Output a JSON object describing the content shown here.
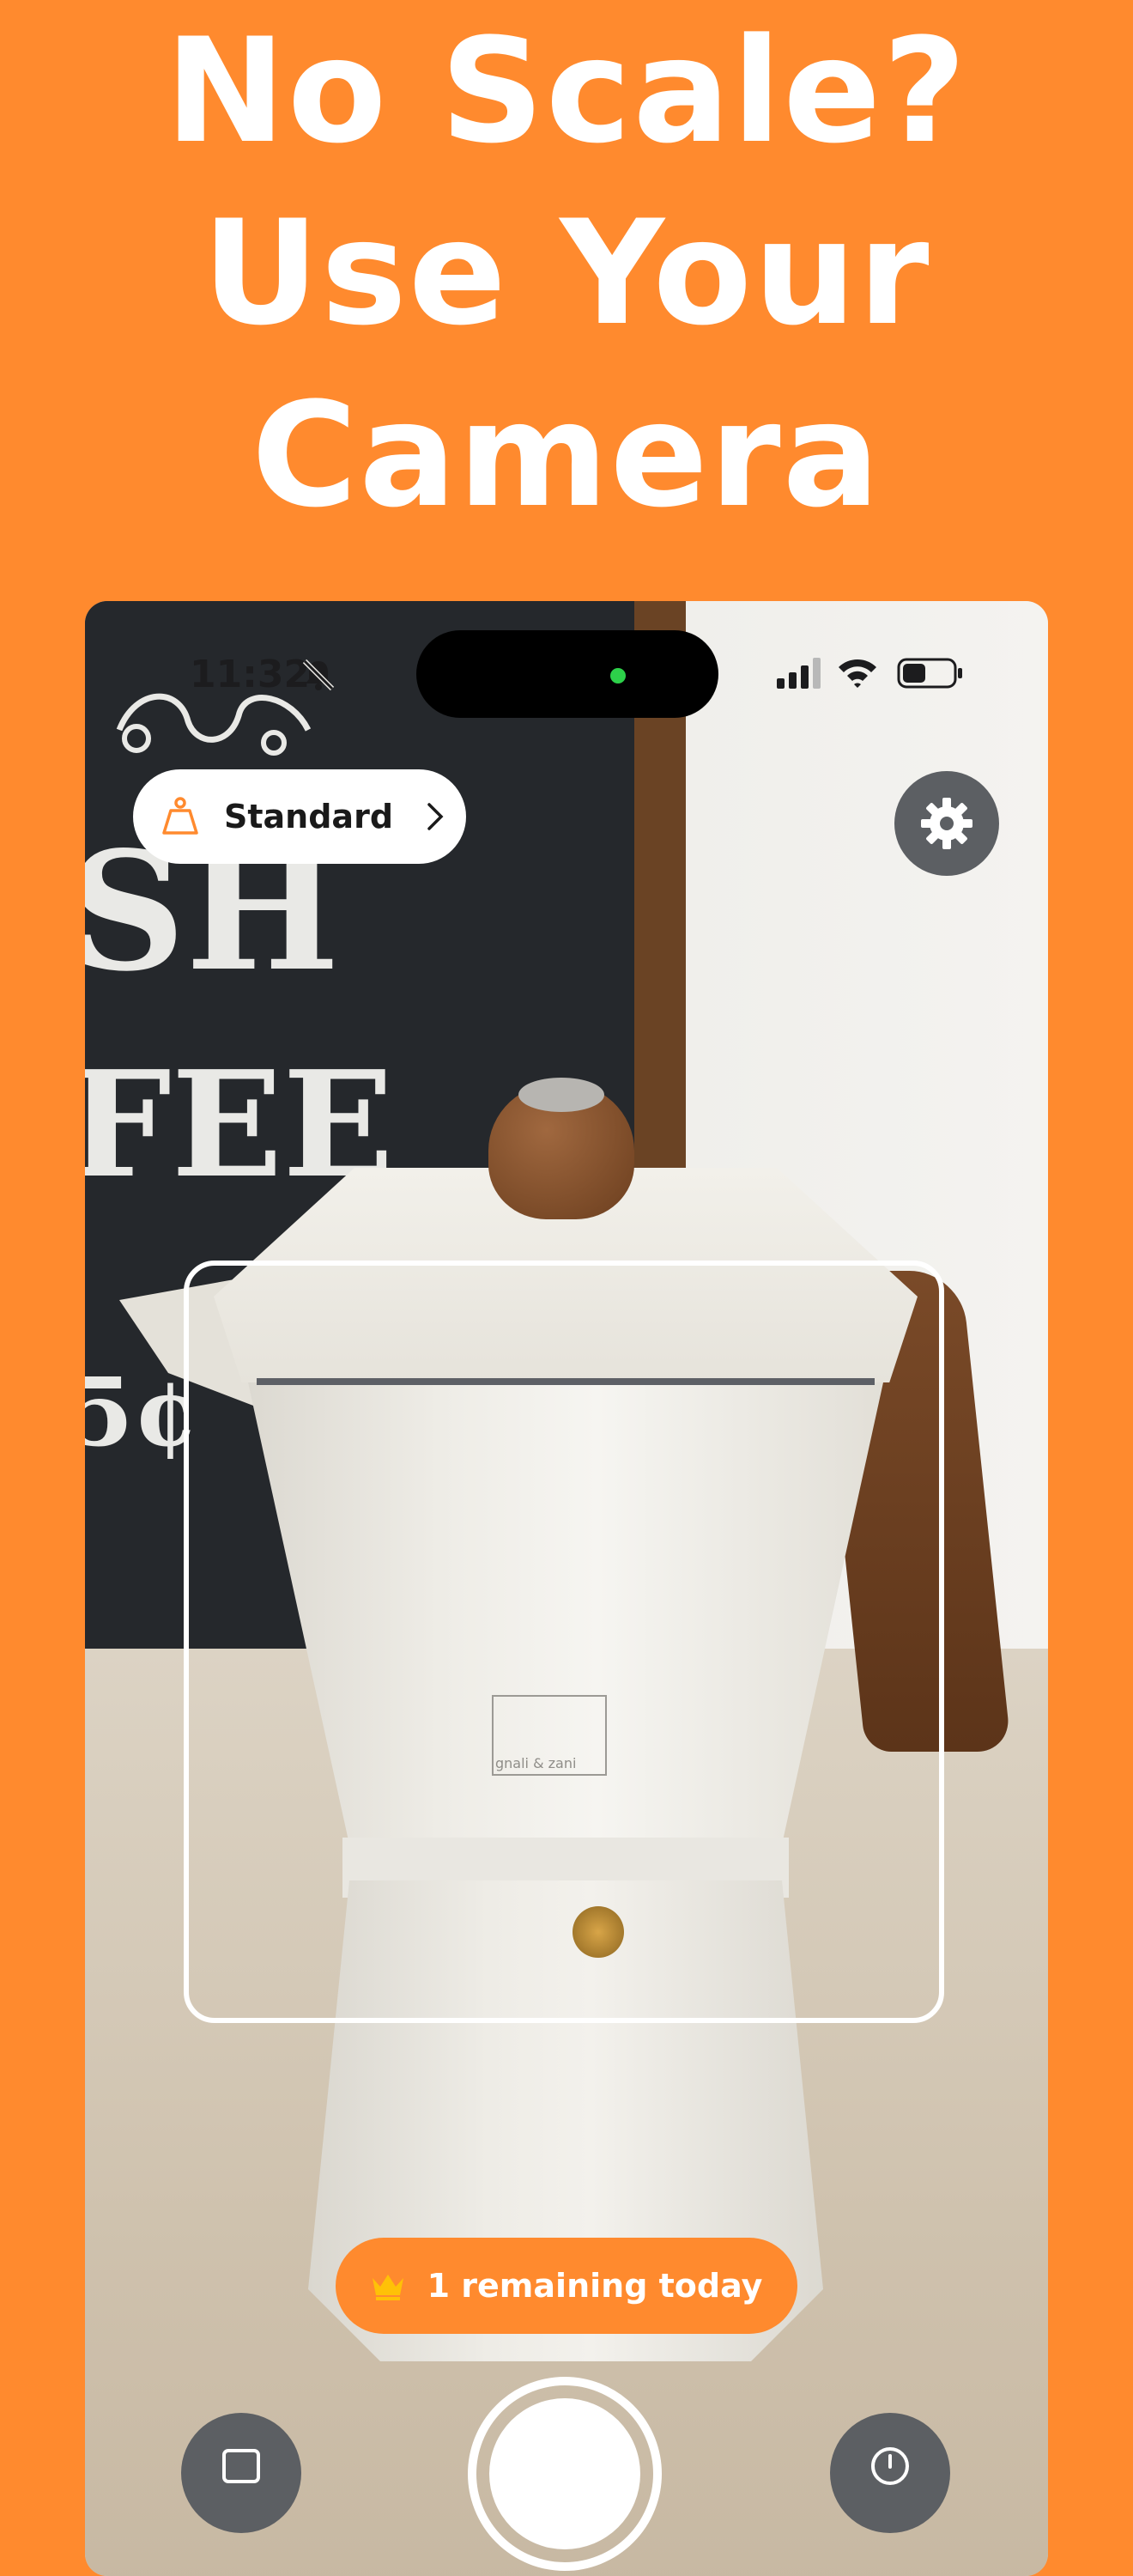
{
  "headline": {
    "line1": "No Scale?",
    "line2": "Use Your",
    "line3": "Camera"
  },
  "status_bar": {
    "time": "11:32",
    "icons": [
      "bell-muted-icon",
      "cellular-signal-icon",
      "wifi-icon",
      "battery-icon"
    ]
  },
  "mode_selector": {
    "icon": "kitchen-scale-icon",
    "label": "Standard",
    "chevron": "chevron-right-icon"
  },
  "settings": {
    "icon": "gear-icon"
  },
  "scene": {
    "board_lines": [
      "SH",
      "FEE",
      "5¢"
    ],
    "pot_brand": "gnali & zani"
  },
  "remaining": {
    "icon": "crown-icon",
    "label": "1 remaining today"
  },
  "controls": {
    "left_icon": "gallery-icon",
    "right_icon": "history-icon"
  },
  "colors": {
    "accent": "#FF8A2E",
    "button_gray": "#5c5f63",
    "crown": "#FFC107"
  }
}
